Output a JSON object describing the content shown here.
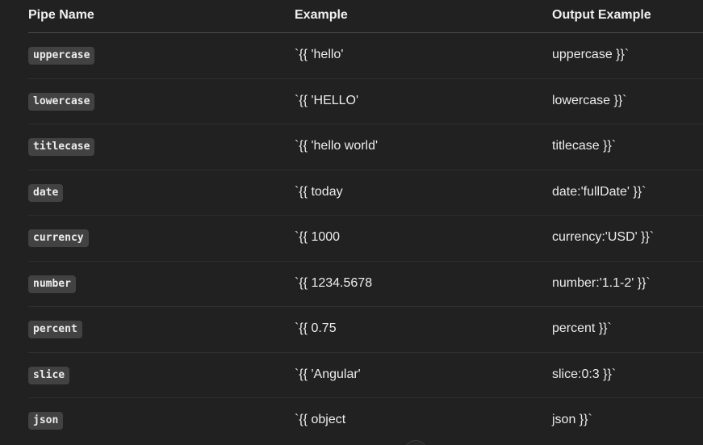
{
  "table": {
    "headers": [
      "Pipe Name",
      "Example",
      "Output Example"
    ],
    "rows": [
      {
        "pipe": "uppercase",
        "example": "`{{ 'hello'",
        "output": "uppercase }}`"
      },
      {
        "pipe": "lowercase",
        "example": "`{{ 'HELLO'",
        "output": "lowercase }}`"
      },
      {
        "pipe": "titlecase",
        "example": "`{{ 'hello world'",
        "output": "titlecase }}`"
      },
      {
        "pipe": "date",
        "example": "`{{ today",
        "output": "date:'fullDate' }}`"
      },
      {
        "pipe": "currency",
        "example": "`{{ 1000",
        "output": "currency:'USD' }}`"
      },
      {
        "pipe": "number",
        "example": "`{{ 1234.5678",
        "output": "number:'1.1-2' }}`"
      },
      {
        "pipe": "percent",
        "example": "`{{ 0.75",
        "output": "percent }}`"
      },
      {
        "pipe": "slice",
        "example": "`{{ 'Angular'",
        "output": "slice:0:3 }}`"
      },
      {
        "pipe": "json",
        "example": "`{{ object",
        "output": "json }}`"
      }
    ]
  },
  "colors": {
    "background": "#212121",
    "text": "#ececec",
    "code_chip_bg": "#424242",
    "header_border": "#4a4a4a",
    "row_border": "#2f2f2f"
  }
}
